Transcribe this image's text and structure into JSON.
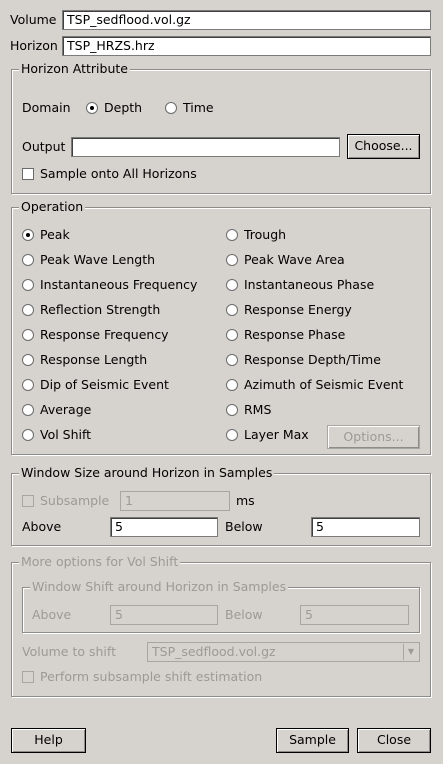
{
  "top": {
    "volume_label": "Volume",
    "volume_value": "TSP_sedflood.vol.gz",
    "horizon_label": "Horizon",
    "horizon_value": "TSP_HRZS.hrz"
  },
  "horizon_attribute": {
    "title": "Horizon Attribute",
    "domain_label": "Domain",
    "depth_label": "Depth",
    "time_label": "Time",
    "selected_domain": "Depth",
    "output_label": "Output",
    "output_value": "",
    "choose_label": "Choose...",
    "sample_all_label": "Sample onto All Horizons",
    "sample_all_checked": false
  },
  "operation": {
    "title": "Operation",
    "selected": "Peak",
    "left": [
      "Peak",
      "Peak Wave Length",
      "Instantaneous Frequency",
      "Reflection Strength",
      "Response Frequency",
      "Response Length",
      "Dip of Seismic Event",
      "Average",
      "Vol Shift"
    ],
    "right": [
      "Trough",
      "Peak Wave Area",
      "Instantaneous Phase",
      "Response Energy",
      "Response Phase",
      "Response Depth/Time",
      "Azimuth of Seismic Event",
      "RMS",
      "Layer Max"
    ],
    "options_label": "Options..."
  },
  "window": {
    "title": "Window Size around Horizon in Samples",
    "subsample_label": "Subsample",
    "subsample_value": "1",
    "ms_label": "ms",
    "above_label": "Above",
    "above_value": "5",
    "below_label": "Below",
    "below_value": "5"
  },
  "volshift": {
    "title": "More options for Vol Shift",
    "shift_title": "Window Shift around Horizon in Samples",
    "above_label": "Above",
    "above_value": "5",
    "below_label": "Below",
    "below_value": "5",
    "volume_label": "Volume to shift",
    "volume_value": "TSP_sedflood.vol.gz",
    "estimate_label": "Perform subsample shift estimation"
  },
  "buttons": {
    "help": "Help",
    "sample": "Sample",
    "close": "Close"
  }
}
